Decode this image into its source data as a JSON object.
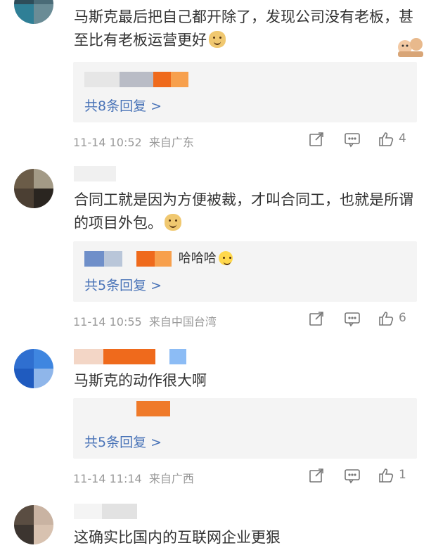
{
  "comments": [
    {
      "text": "马斯克最后把自己都开除了，发现公司没有老板，甚至比有老板运营更好",
      "reply_more": "共8条回复 >",
      "time": "11-14 10:52",
      "source": "来自广东",
      "likes": "4"
    },
    {
      "text": "合同工就是因为方便被裁，才叫合同工，也就是所谓的项目外包。",
      "reply_snippet": "哈哈哈",
      "reply_more": "共5条回复 >",
      "time": "11-14 10:55",
      "source": "来自中国台湾",
      "likes": "6"
    },
    {
      "text": "马斯克的动作很大啊",
      "reply_more": "共5条回复 >",
      "time": "11-14 11:14",
      "source": "来自广西",
      "likes": "1"
    },
    {
      "text": "这确实比国内的互联网企业更狠"
    }
  ],
  "icons": {
    "share": "share-icon",
    "comment": "comment-icon",
    "like": "like-icon"
  },
  "colors": {
    "link": "#4a74b8",
    "meta": "#999999",
    "reply_bg": "#f4f4f4"
  }
}
